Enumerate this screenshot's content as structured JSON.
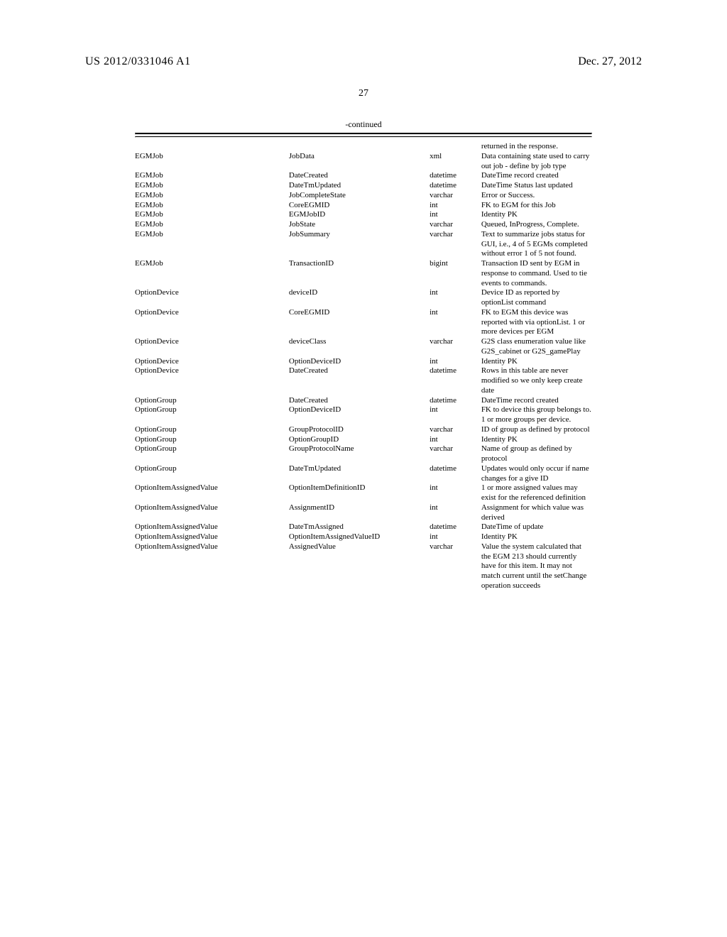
{
  "header": {
    "pub_number": "US 2012/0331046 A1",
    "pub_date": "Dec. 27, 2012"
  },
  "page_number": "27",
  "table": {
    "continued_label": "-continued",
    "lead_desc": "returned in the response.",
    "rows": [
      {
        "t": "EGMJob",
        "f": "JobData",
        "ty": "xml",
        "d": "Data containing state used to carry out job - define by job type"
      },
      {
        "t": "EGMJob",
        "f": "DateCreated",
        "ty": "datetime",
        "d": "DateTime record created"
      },
      {
        "t": "EGMJob",
        "f": "DateTmUpdated",
        "ty": "datetime",
        "d": "DateTime Status last updated"
      },
      {
        "t": "EGMJob",
        "f": "JobCompleteState",
        "ty": "varchar",
        "d": "Error or Success."
      },
      {
        "t": "EGMJob",
        "f": "CoreEGMID",
        "ty": "int",
        "d": "FK to EGM for this Job"
      },
      {
        "t": "EGMJob",
        "f": "EGMJobID",
        "ty": "int",
        "d": "Identity PK"
      },
      {
        "t": "EGMJob",
        "f": "JobState",
        "ty": "varchar",
        "d": "Queued, InProgress, Complete."
      },
      {
        "t": "EGMJob",
        "f": "JobSummary",
        "ty": "varchar",
        "d": "Text to summarize jobs status for GUI, i.e., 4 of 5 EGMs completed without error 1 of 5 not found."
      },
      {
        "t": "EGMJob",
        "f": "TransactionID",
        "ty": "bigint",
        "d": "Transaction ID sent by EGM in response to command. Used to tie events to commands."
      },
      {
        "t": "OptionDevice",
        "f": "deviceID",
        "ty": "int",
        "d": "Device ID as reported by optionList command"
      },
      {
        "t": "OptionDevice",
        "f": "CoreEGMID",
        "ty": "int",
        "d": "FK to EGM this device was reported with via optionList. 1 or more devices per EGM"
      },
      {
        "t": "OptionDevice",
        "f": "deviceClass",
        "ty": "varchar",
        "d": "G2S class enumeration value like G2S_cabinet or G2S_gamePlay"
      },
      {
        "t": "OptionDevice",
        "f": "OptionDeviceID",
        "ty": "int",
        "d": "Identity PK"
      },
      {
        "t": "OptionDevice",
        "f": "DateCreated",
        "ty": "datetime",
        "d": "Rows in this table are never modified so we only keep create date"
      },
      {
        "t": "OptionGroup",
        "f": "DateCreated",
        "ty": "datetime",
        "d": "DateTime record created"
      },
      {
        "t": "OptionGroup",
        "f": "OptionDeviceID",
        "ty": "int",
        "d": "FK to device this group belongs to. 1 or more groups per device."
      },
      {
        "t": "OptionGroup",
        "f": "GroupProtocolID",
        "ty": "varchar",
        "d": "ID of group as defined by protocol"
      },
      {
        "t": "OptionGroup",
        "f": "OptionGroupID",
        "ty": "int",
        "d": "Identity PK"
      },
      {
        "t": "OptionGroup",
        "f": "GroupProtocolName",
        "ty": "varchar",
        "d": "Name of group as defined by protocol"
      },
      {
        "t": "OptionGroup",
        "f": "DateTmUpdated",
        "ty": "datetime",
        "d": "Updates would only occur if name changes for a give ID"
      },
      {
        "t": "OptionItemAssignedValue",
        "f": "OptionItemDefinitionID",
        "ty": "int",
        "d": "1 or more assigned values may exist for the referenced definition"
      },
      {
        "t": "OptionItemAssignedValue",
        "f": "AssignmentID",
        "ty": "int",
        "d": "Assignment for which value was derived"
      },
      {
        "t": "OptionItemAssignedValue",
        "f": "DateTmAssigned",
        "ty": "datetime",
        "d": "DateTime of update"
      },
      {
        "t": "OptionItemAssignedValue",
        "f": "OptionItemAssignedValueID",
        "ty": "int",
        "d": "Identity PK"
      },
      {
        "t": "OptionItemAssignedValue",
        "f": "AssignedValue",
        "ty": "varchar",
        "d": "Value the system calculated that the EGM 213 should currently have for this item. It may not match current until the setChange operation succeeds"
      }
    ]
  }
}
